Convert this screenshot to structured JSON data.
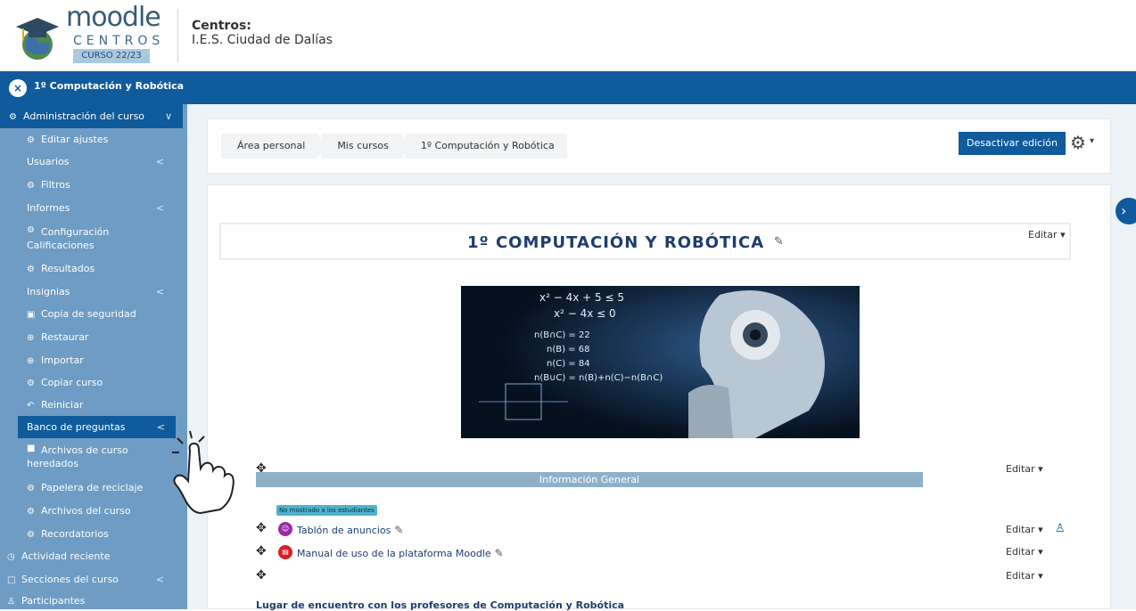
{
  "header": {
    "logo_word": "moodle",
    "logo_sub": "CENTROS",
    "logo_curso": "CURSO 22/23",
    "center_label": "Centros:",
    "center_name": "I.E.S. Ciudad de Dalías"
  },
  "topbar": {
    "close_icon": "×",
    "title": "1º Computación y Robótica"
  },
  "sidebar": {
    "items": [
      {
        "label": "Administración del curso",
        "icon": "gear-icon",
        "chevron": "∨",
        "active": true
      },
      {
        "label": "Editar ajustes",
        "icon": "gear-icon"
      },
      {
        "label": "Usuarios",
        "icon": "",
        "chevron": "<"
      },
      {
        "label": "Filtros",
        "icon": "gear-icon"
      },
      {
        "label": "Informes",
        "icon": "",
        "chevron": "<"
      },
      {
        "label": "Configuración Calificaciones",
        "icon": "gear-icon"
      },
      {
        "label": "Resultados",
        "icon": "gear-icon"
      },
      {
        "label": "Insignias",
        "icon": "",
        "chevron": "<"
      },
      {
        "label": "Copia de seguridad",
        "icon": "backup-icon"
      },
      {
        "label": "Restaurar",
        "icon": "restore-icon"
      },
      {
        "label": "Importar",
        "icon": "import-icon"
      },
      {
        "label": "Copiar curso",
        "icon": "gear-icon"
      },
      {
        "label": "Reiniciar",
        "icon": "reset-icon"
      },
      {
        "label": "Banco de preguntas",
        "icon": "",
        "chevron": "<",
        "active": true
      },
      {
        "label": "Archivos de curso heredados",
        "icon": "folder-icon"
      },
      {
        "label": "Papelera de reciclaje",
        "icon": "gear-icon"
      },
      {
        "label": "Archivos del curso",
        "icon": "gear-icon"
      },
      {
        "label": "Recordatorios",
        "icon": "gear-icon"
      },
      {
        "label": "Actividad reciente",
        "icon": "clock-icon"
      },
      {
        "label": "Secciones del curso",
        "icon": "folder-icon",
        "chevron": "<"
      },
      {
        "label": "Participantes",
        "icon": "people-icon"
      }
    ]
  },
  "breadcrumb": [
    "Área personal",
    "Mis cursos",
    "1º Computación y Robótica"
  ],
  "actions": {
    "toggle_edit": "Desactivar edición"
  },
  "course": {
    "title": "1º COMPUTACIÓN Y ROBÓTICA",
    "edit_label": "Editar",
    "image_text": [
      "x² − 4x + 5 ≤ 5",
      "x² − 4x ≤ 0",
      "n(B∩C) = 22",
      "n(B) = 68",
      "n(C) = 84",
      "n(B∪C) = n(B)+n(C)−n(B∩C)"
    ]
  },
  "section": {
    "title": "Información General",
    "hidden_badge": "No mostrado a los estudiantes",
    "activities": [
      {
        "label": "Tablón de anuncios",
        "icon": "forum-icon",
        "color": "#9b2aa7"
      },
      {
        "label": "Manual de uso de la plataforma Moodle",
        "icon": "pdf-icon",
        "color": "#d61f26"
      }
    ],
    "next_text": "Lugar de encuentro con los profesores de Computación y Robótica"
  },
  "colors": {
    "primary": "#0f5b9c",
    "sidebar": "#6e9cc4",
    "section_bar": "#8fb0c9"
  }
}
